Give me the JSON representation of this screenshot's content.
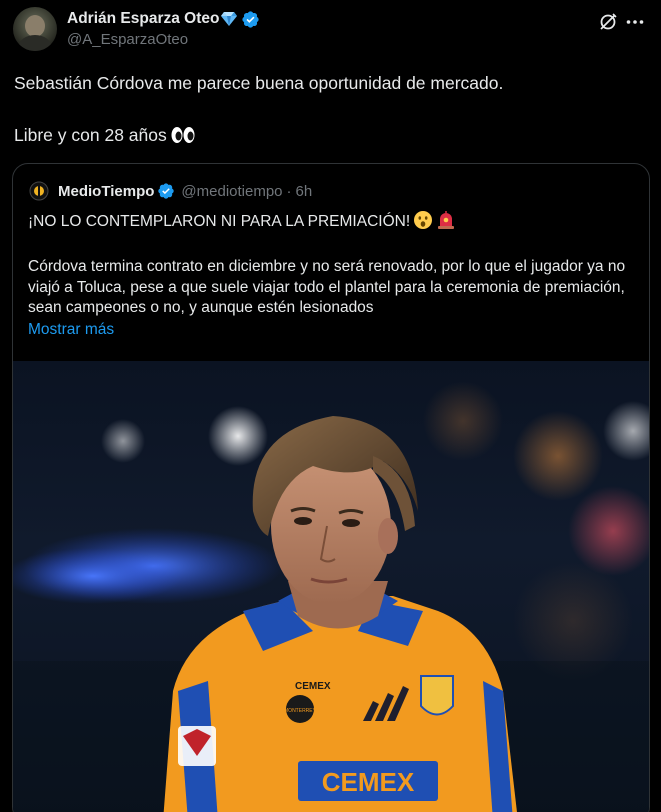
{
  "tweet": {
    "author": {
      "display_name": "Adrián Esparza Oteo",
      "handle": "@A_EsparzaOteo",
      "verified": true
    },
    "text_line1": "Sebastián Córdova me parece buena oportunidad de mercado.",
    "text_line2": "Libre y con 28 años",
    "header_icons": [
      "grok-icon",
      "more-icon"
    ]
  },
  "quote": {
    "author": {
      "display_name": "MedioTiempo",
      "handle": "@mediotiempo",
      "separator": "·",
      "time": "6h",
      "verified": true
    },
    "headline": "¡NO LO CONTEMPLARON NI PARA LA PREMIACIÓN!",
    "body": "Córdova termina contrato en diciembre y no será renovado, por lo que el jugador ya no viajó a Toluca, pese a que suele viajar todo el plantel para la ceremonia de premiación, sean campeones o no, y aunque estén lesionados",
    "show_more": "Mostrar más",
    "media": {
      "jersey_sponsor": "CEMEX",
      "jersey_badge": "MONTERREY"
    }
  },
  "colors": {
    "background": "#000000",
    "text": "#e7e9ea",
    "secondary": "#71767b",
    "link": "#1d9bf0",
    "border": "#2f3336",
    "verified": "#1d9bf0",
    "jersey_orange": "#f29a1f",
    "jersey_blue": "#1f4fb3"
  }
}
